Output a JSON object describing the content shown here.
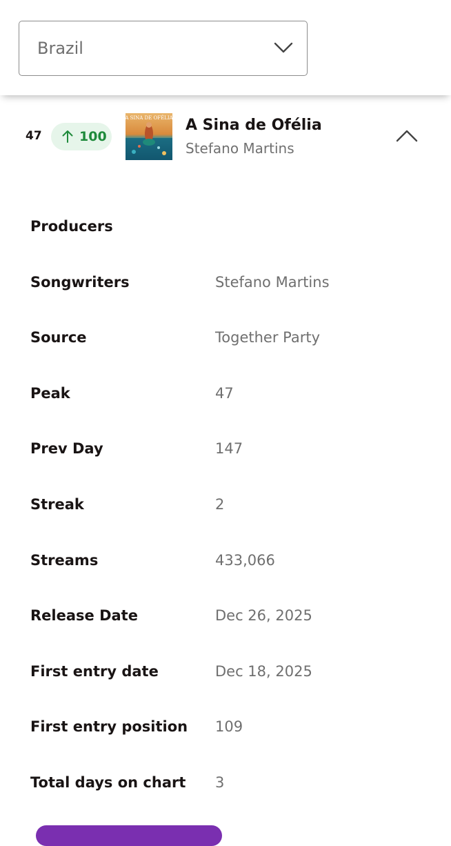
{
  "country_select": {
    "value": "Brazil",
    "icon": "chevron-down-icon"
  },
  "track": {
    "rank": "47",
    "change": "100",
    "change_direction": "up",
    "change_color": "#1e8a3b",
    "title": "A Sina de Ofélia",
    "artist": "Stefano Martins",
    "cover_text": "A SINA DE OFÉLIA",
    "collapse_icon": "chevron-up-icon"
  },
  "details": [
    {
      "label": "Producers",
      "value": ""
    },
    {
      "label": "Songwriters",
      "value": "Stefano Martins"
    },
    {
      "label": "Source",
      "value": "Together Party"
    },
    {
      "label": "Peak",
      "value": "47"
    },
    {
      "label": "Prev Day",
      "value": "147"
    },
    {
      "label": "Streak",
      "value": "2"
    },
    {
      "label": "Streams",
      "value": "433,066"
    },
    {
      "label": "Release Date",
      "value": "Dec 26, 2025"
    },
    {
      "label": "First entry date",
      "value": "Dec 18, 2025"
    },
    {
      "label": "First entry position",
      "value": "109"
    },
    {
      "label": "Total days on chart",
      "value": "3"
    }
  ],
  "colors": {
    "accent_button": "#7a2fb0",
    "badge_bg": "#e6f5ea"
  }
}
